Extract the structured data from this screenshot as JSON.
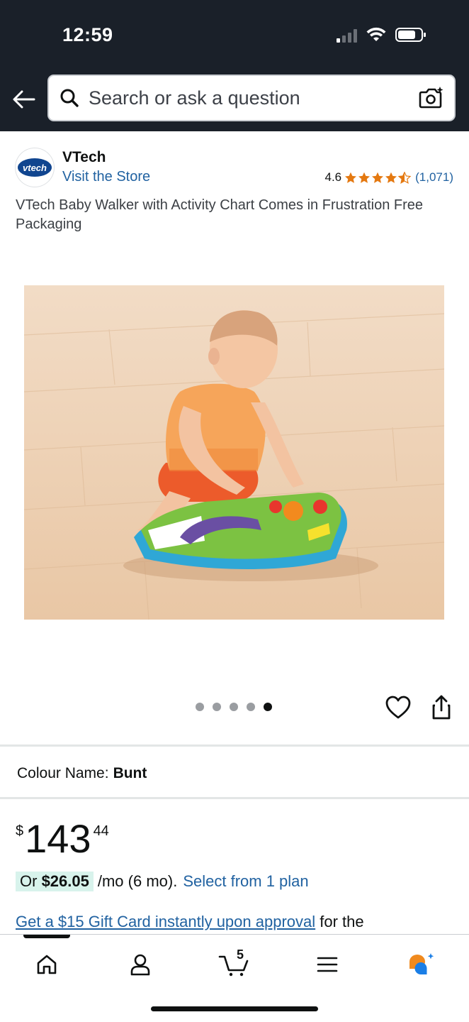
{
  "status_bar": {
    "time": "12:59"
  },
  "header": {
    "back_icon": "arrow-left-icon",
    "search_placeholder": "Search or ask a question",
    "camera_icon": "camera-search-icon"
  },
  "brand": {
    "logo_text": "vtech",
    "name": "VTech",
    "store_link": "Visit the Store",
    "rating": "4.6",
    "rating_value": 4.6,
    "review_count": "(1,071)"
  },
  "product": {
    "title": "VTech Baby Walker with Activity Chart Comes in Frustration Free Packaging",
    "image_description_icon": "product-photo",
    "carousel_total": 5,
    "carousel_active": 5
  },
  "colour": {
    "label": "Colour Name:",
    "value": "Bunt"
  },
  "price": {
    "symbol": "$",
    "whole": "143",
    "fraction": "44"
  },
  "monthly": {
    "prefix": "Or ",
    "amount": "$26.05",
    "term": "/mo (6 mo).",
    "plan_link": "Select from 1 plan"
  },
  "gift": {
    "link": "Get a $15 Gift Card instantly upon approval",
    "suffix": " for the"
  },
  "bottom_nav": {
    "cart_count": "5",
    "items": [
      "home-icon",
      "account-icon",
      "cart-icon",
      "menu-icon",
      "assistant-icon"
    ]
  },
  "colors": {
    "header_bg": "#1a2029",
    "link": "#2162a1",
    "star": "#e47911",
    "badge_bg": "#d8f3ec"
  }
}
